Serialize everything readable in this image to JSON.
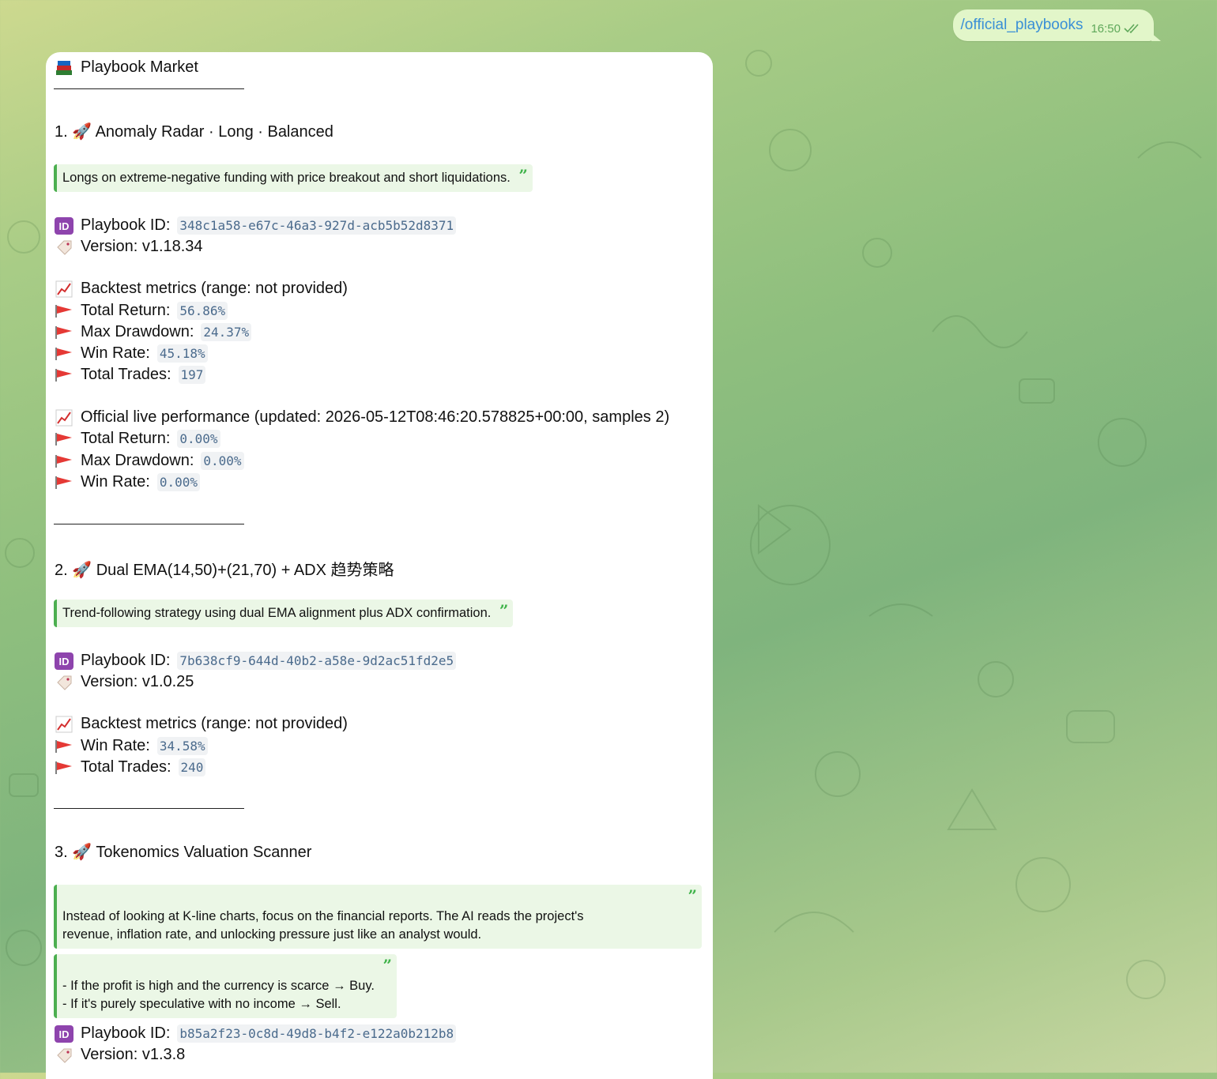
{
  "outgoing": {
    "command": "/official_playbooks",
    "time": "16:50",
    "status_icon": "double-check-icon"
  },
  "card": {
    "header": "Playbook Market",
    "playbooks": [
      {
        "title": "1. 🚀 Anomaly Radar · Long · Balanced",
        "quotes": [
          "Longs on extreme-negative funding with price breakout and short liquidations."
        ],
        "id_label": "Playbook ID:",
        "id": "348c1a58-e67c-46a3-927d-acb5b52d8371",
        "version": "Version: v1.18.34",
        "backtest_header": "Backtest metrics (range: not provided)",
        "backtest": [
          {
            "label": "Total Return:",
            "value": "56.86%"
          },
          {
            "label": "Max Drawdown:",
            "value": "24.37%"
          },
          {
            "label": "Win Rate:",
            "value": "45.18%"
          },
          {
            "label": "Total Trades:",
            "value": "197"
          }
        ],
        "live_header": "Official live performance (updated: 2026-05-12T08:46:20.578825+00:00, samples 2)",
        "live": [
          {
            "label": "Total Return:",
            "value": "0.00%"
          },
          {
            "label": "Max Drawdown:",
            "value": "0.00%"
          },
          {
            "label": "Win Rate:",
            "value": "0.00%"
          }
        ]
      },
      {
        "title": "2. 🚀 Dual EMA(14,50)+(21,70) + ADX 趋势策略",
        "quotes": [
          "Trend-following strategy using dual EMA alignment plus ADX confirmation."
        ],
        "id_label": "Playbook ID:",
        "id": "7b638cf9-644d-40b2-a58e-9d2ac51fd2e5",
        "version": "Version: v1.0.25",
        "backtest_header": "Backtest metrics (range: not provided)",
        "backtest": [
          {
            "label": "Win Rate:",
            "value": "34.58%"
          },
          {
            "label": "Total Trades:",
            "value": "240"
          }
        ]
      },
      {
        "title": "3. 🚀 Tokenomics Valuation Scanner",
        "quotes": [
          "Instead of looking at K-line charts, focus on the financial reports. The AI reads the project's\nrevenue, inflation rate, and unlocking pressure just like an analyst would.",
          "- If the profit is high and the currency is scarce → Buy.\n- If it's purely speculative with no income → Sell."
        ],
        "id_label": "Playbook ID:",
        "id": "b85a2f23-0c8d-49d8-b4f2-e122a0b212b8",
        "version": "Version: v1.3.8"
      }
    ]
  },
  "colors": {
    "quote_bar": "#4caf50",
    "code_text": "#4a6a8c",
    "link": "#3a8fd6",
    "bubble_out": "#e2f6c9"
  }
}
